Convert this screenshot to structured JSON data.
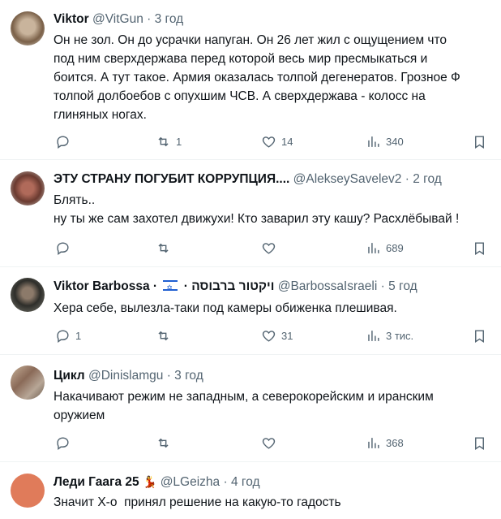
{
  "tweets": [
    {
      "name": "Viktor",
      "handle": "@VitGun",
      "time": "3 год",
      "lines": [
        "Он не зол. Он до усрачки напуган. Он 26 лет жил с ощущением что",
        "под ним сверхдержава перед которой весь мир пресмыкаться и",
        "боится. А тут такое. Армия оказалась толпой дегенератов. Грозное Ф",
        "толпой долбоебов с опухшим ЧСВ. А сверхдержава - колосс на",
        "глиняных ногах."
      ],
      "replies": "",
      "retweets": "1",
      "likes": "14",
      "views": "340",
      "avatar_color": "#9a7a5e"
    },
    {
      "name": "ЭТУ СТРАНУ ПОГУБИТ КОРРУПЦИЯ....",
      "handle": "@AlekseySavelev2",
      "time": "2 год",
      "lines": [
        "Блять..",
        "ну ты же сам захотел движухи! Кто заварил эту кашу? Расхлёбывай !"
      ],
      "replies": "",
      "retweets": "",
      "likes": "",
      "views": "689",
      "avatar_color": "#8a4a40"
    },
    {
      "name": "Viktor Barbossa",
      "name_suffix": "ויקטור ברבוסה",
      "handle": "@BarbossaIsraeli",
      "time": "5 год",
      "lines": [
        "Хера себе, вылезла-таки под камеры обиженка плешивая."
      ],
      "replies": "1",
      "retweets": "",
      "likes": "31",
      "views": "3 тис.",
      "avatar_color": "#4a4a44"
    },
    {
      "name": "Цикл",
      "handle": "@Dinislamgu",
      "time": "3 год",
      "lines": [
        "Накачивают режим не западным, а северокорейским и иранским",
        "оружием"
      ],
      "replies": "",
      "retweets": "",
      "likes": "",
      "views": "368",
      "avatar_color": "#a88a70"
    },
    {
      "name": "Леди Гаага 25",
      "handle": "@LGeizha",
      "time": "4 год",
      "lines": [
        "Значит Х-о  принял решение на какую-то гадость"
      ],
      "avatar_color": "#e07b5a"
    }
  ],
  "separator": "·",
  "colors": {
    "text": "#0f1419",
    "muted": "#536471",
    "border": "#eff3f4"
  }
}
